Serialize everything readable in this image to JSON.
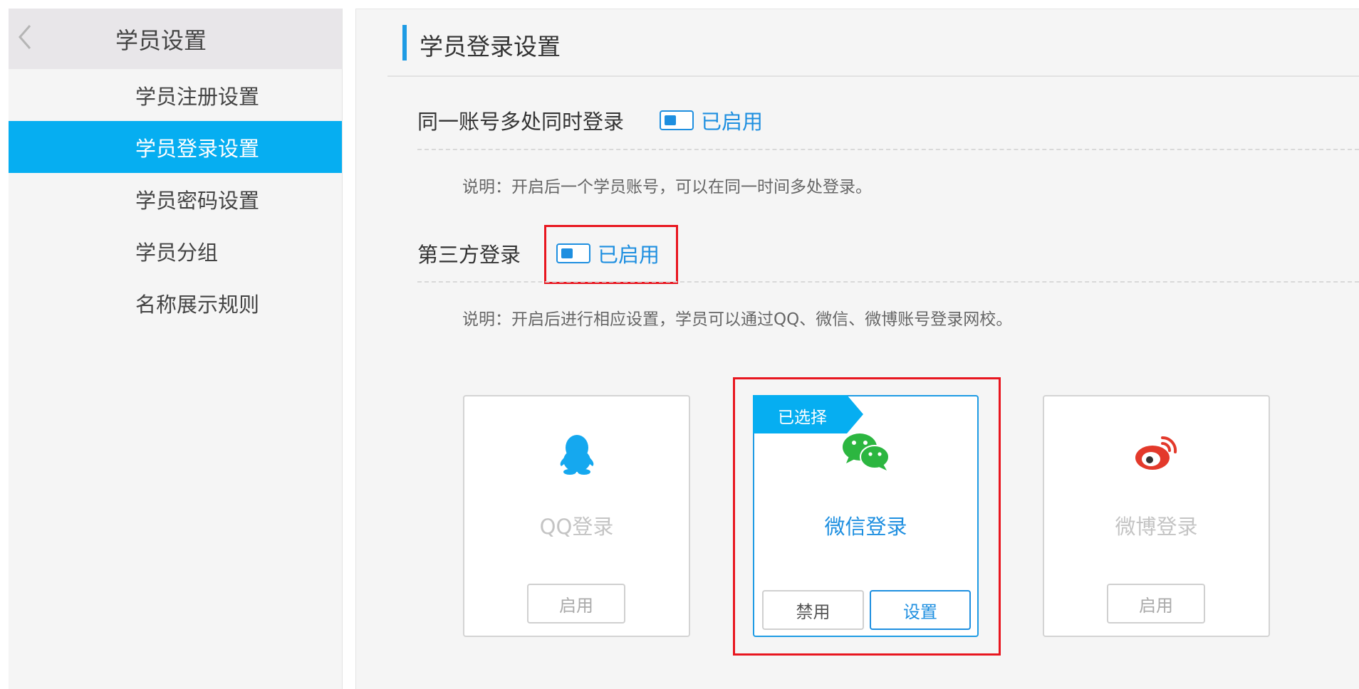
{
  "sidebar": {
    "title": "学员设置",
    "items": [
      {
        "label": "学员注册设置",
        "active": false
      },
      {
        "label": "学员登录设置",
        "active": true
      },
      {
        "label": "学员密码设置",
        "active": false
      },
      {
        "label": "学员分组",
        "active": false
      },
      {
        "label": "名称展示规则",
        "active": false
      }
    ]
  },
  "main": {
    "title": "学员登录设置",
    "multi_login": {
      "label": "同一账号多处同时登录",
      "status": "已启用",
      "desc": "说明：开启后一个学员账号，可以在同一时间多处登录。"
    },
    "third_party": {
      "label": "第三方登录",
      "status": "已启用",
      "desc": "说明：开启后进行相应设置，学员可以通过QQ、微信、微博账号登录网校。"
    },
    "providers": [
      {
        "name": "QQ登录",
        "icon": "qq-icon",
        "button": "启用",
        "selected": false
      },
      {
        "name": "微信登录",
        "icon": "wechat-icon",
        "selected": true,
        "badge": "已选择",
        "disable_label": "禁用",
        "setup_label": "设置"
      },
      {
        "name": "微博登录",
        "icon": "weibo-icon",
        "button": "启用",
        "selected": false
      }
    ]
  },
  "colors": {
    "accent": "#06aef1",
    "link": "#1e8fe0",
    "highlight": "#e8161f",
    "wechat": "#2cb640",
    "qq": "#15a8ef",
    "weibo": "#e3392b"
  }
}
